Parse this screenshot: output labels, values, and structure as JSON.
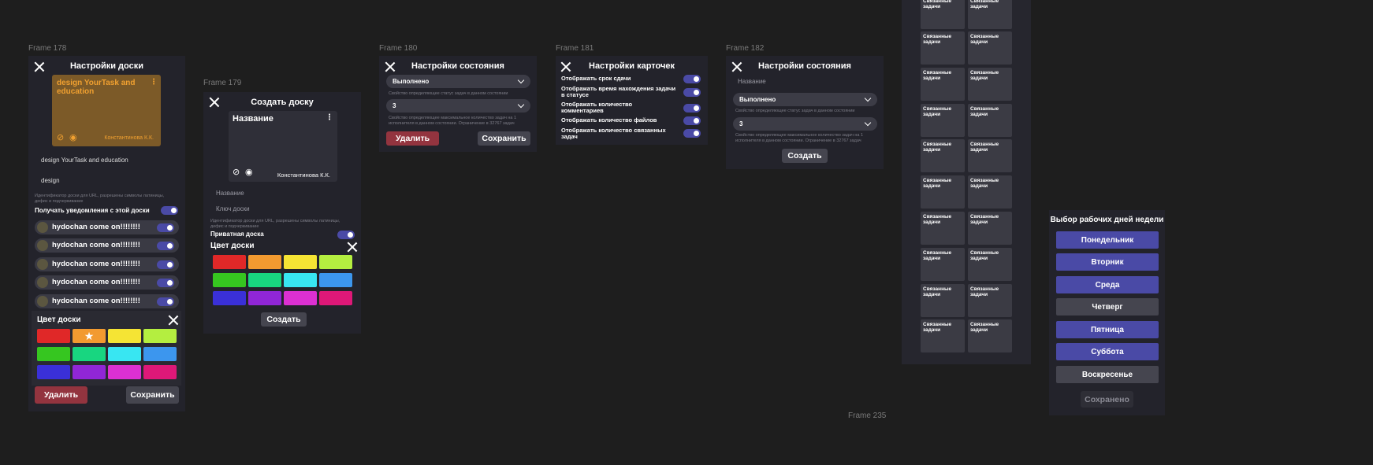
{
  "colors": {
    "bg": "#1e1e1e",
    "panel": "#23232b",
    "accent": "#4a4aa6",
    "danger": "#93343f",
    "card_bg": "#7c5a28",
    "card_text": "#f0a030"
  },
  "frame178": {
    "label": "Frame 178",
    "title": "Настройки доски",
    "card": {
      "title": "design YourTask and education",
      "author": "Константинова К.К."
    },
    "name_value": "design YourTask and education",
    "key_value": "design",
    "key_hint": "Идентификатор доски для URL, разрешены символы латиницы, дефис и подчеркивание",
    "notify_label": "Получать уведомления с этой доски",
    "users": [
      {
        "name": "hydochan come on!!!!!!!!"
      },
      {
        "name": "hydochan come on!!!!!!!!"
      },
      {
        "name": "hydochan come on!!!!!!!!"
      },
      {
        "name": "hydochan come on!!!!!!!!"
      },
      {
        "name": "hydochan come on!!!!!!!!"
      }
    ],
    "color_title": "Цвет доски",
    "selected_mark": "★",
    "delete": "Удалить",
    "save": "Сохранить"
  },
  "frame179": {
    "label": "Frame 179",
    "title": "Создать доску",
    "card": {
      "title": "Название",
      "author": "Константинова К.К."
    },
    "name_placeholder": "Название",
    "key_placeholder": "Ключ доски",
    "key_hint": "Идентификатор доски для URL, разрешены символы латиницы, дефис и подчеркивание",
    "private_label": "Приватная доска",
    "color_title": "Цвет доски",
    "create": "Создать"
  },
  "frame180": {
    "label": "Frame 180",
    "title": "Настройки состояния",
    "status_value": "Выполнено",
    "status_hint": "Свойство определяющее статус задач в данном состоянии",
    "limit_value": "3",
    "limit_hint": "Свойство определяющее максимальное количество задач на 1 исполнителя в данном состоянии. Ограничение в 32767 задач",
    "delete": "Удалить",
    "save": "Сохранить"
  },
  "frame181": {
    "label": "Frame 181",
    "title": "Настройки карточек",
    "options": [
      {
        "label": "Отображать срок сдачи"
      },
      {
        "label": "Отображать время нахождения задачи в статусе"
      },
      {
        "label": "Отображать количество комментариев"
      },
      {
        "label": "Отображать количество файлов"
      },
      {
        "label": "Отображать количество связанных задач"
      }
    ]
  },
  "frame182": {
    "label": "Frame 182",
    "title": "Настройки состояния",
    "name_placeholder": "Название",
    "status_value": "Выполнено",
    "status_hint": "Свойство определяющее статус задач в данном состоянии",
    "limit_value": "3",
    "limit_hint": "Свойство определяющее максимальное количество задач на 1 исполнителя в данном состоянии. Ограничение в 32767 задач",
    "create": "Создать"
  },
  "cards": {
    "label": "Связанные задачи"
  },
  "frame235": {
    "label": "Frame 235",
    "title": "Выбор рабочих дней недели",
    "days": [
      {
        "name": "Понедельник",
        "active": true
      },
      {
        "name": "Вторник",
        "active": true
      },
      {
        "name": "Среда",
        "active": true
      },
      {
        "name": "Четверг",
        "active": false
      },
      {
        "name": "Пятница",
        "active": true
      },
      {
        "name": "Суббота",
        "active": true
      },
      {
        "name": "Воскресенье",
        "active": false
      }
    ],
    "saved": "Сохранено"
  },
  "palette": [
    "#e02828",
    "#f29a30",
    "#f5e434",
    "#b4ee40",
    "#36c620",
    "#18d680",
    "#38e6f2",
    "#3c96ee",
    "#3a30d8",
    "#9026d6",
    "#dc30d2",
    "#de1878"
  ]
}
